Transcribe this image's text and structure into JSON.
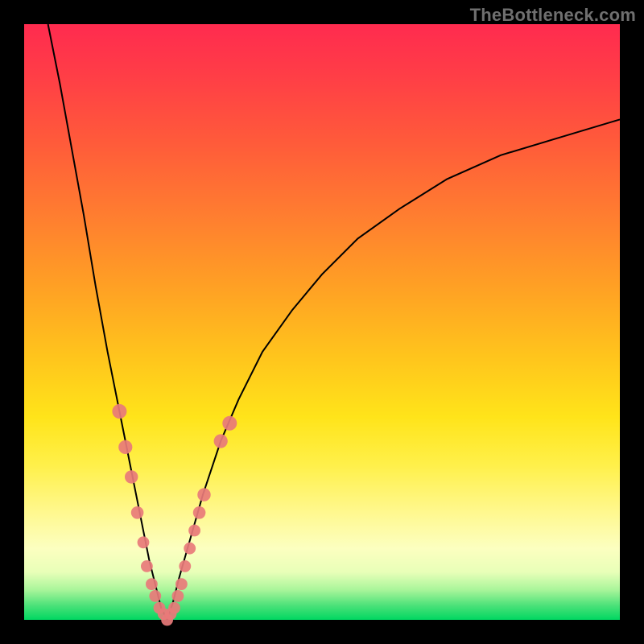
{
  "watermark": "TheBottleneck.com",
  "colors": {
    "bead": "#e87a7a",
    "curve": "#000000",
    "frame": "#000000"
  },
  "chart_data": {
    "type": "line",
    "title": "",
    "xlabel": "",
    "ylabel": "",
    "x_range": [
      0,
      100
    ],
    "y_range": [
      0,
      100
    ],
    "notch_x": 24,
    "left_branch": {
      "x": [
        4,
        6,
        8,
        10,
        12,
        14,
        16,
        18,
        20,
        21,
        22,
        23,
        24
      ],
      "y": [
        100,
        90,
        79,
        68,
        56,
        45,
        35,
        25,
        15,
        10,
        6,
        2,
        0
      ]
    },
    "right_branch": {
      "x": [
        24,
        25,
        26,
        28,
        30,
        33,
        36,
        40,
        45,
        50,
        56,
        63,
        71,
        80,
        90,
        100
      ],
      "y": [
        0,
        3,
        7,
        14,
        21,
        30,
        37,
        45,
        52,
        58,
        64,
        69,
        74,
        78,
        81,
        84
      ]
    },
    "beads_left": [
      {
        "x": 16,
        "y": 35
      },
      {
        "x": 17,
        "y": 29
      },
      {
        "x": 18,
        "y": 24
      },
      {
        "x": 19,
        "y": 18
      },
      {
        "x": 20,
        "y": 13
      },
      {
        "x": 20.6,
        "y": 9
      },
      {
        "x": 21.4,
        "y": 6
      },
      {
        "x": 22,
        "y": 4
      },
      {
        "x": 22.7,
        "y": 2
      },
      {
        "x": 23.4,
        "y": 1
      },
      {
        "x": 24,
        "y": 0
      }
    ],
    "beads_right": [
      {
        "x": 24.6,
        "y": 1
      },
      {
        "x": 25.2,
        "y": 2
      },
      {
        "x": 25.8,
        "y": 4
      },
      {
        "x": 26.4,
        "y": 6
      },
      {
        "x": 27,
        "y": 9
      },
      {
        "x": 27.8,
        "y": 12
      },
      {
        "x": 28.6,
        "y": 15
      },
      {
        "x": 29.4,
        "y": 18
      },
      {
        "x": 30.2,
        "y": 21
      },
      {
        "x": 33,
        "y": 30
      },
      {
        "x": 34.5,
        "y": 33
      }
    ]
  }
}
